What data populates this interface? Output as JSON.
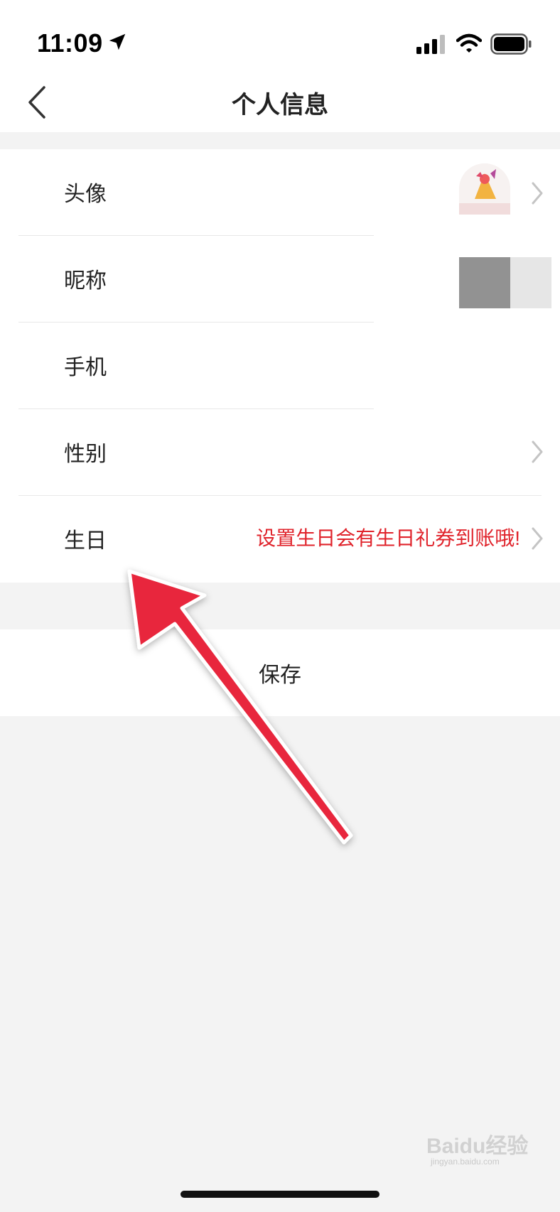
{
  "status_bar": {
    "time": "11:09",
    "icons": [
      "location-arrow-icon",
      "cellular-signal-icon",
      "wifi-icon",
      "battery-icon"
    ]
  },
  "nav": {
    "title": "个人信息",
    "back_icon": "chevron-left-icon"
  },
  "form": {
    "rows": [
      {
        "label": "头像",
        "value": ""
      },
      {
        "label": "昵称",
        "value": ""
      },
      {
        "label": "手机",
        "value": ""
      },
      {
        "label": "性别",
        "value": ""
      },
      {
        "label": "生日",
        "value": "设置生日会有生日礼券到账哦!"
      }
    ]
  },
  "save": {
    "label": "保存"
  },
  "watermark": {
    "brand": "Baidu经验",
    "url": "jingyan.baidu.com"
  },
  "colors": {
    "accent_red": "#e0232b",
    "arrow_red": "#e8283c",
    "background": "#f3f3f3",
    "card": "#ffffff"
  }
}
